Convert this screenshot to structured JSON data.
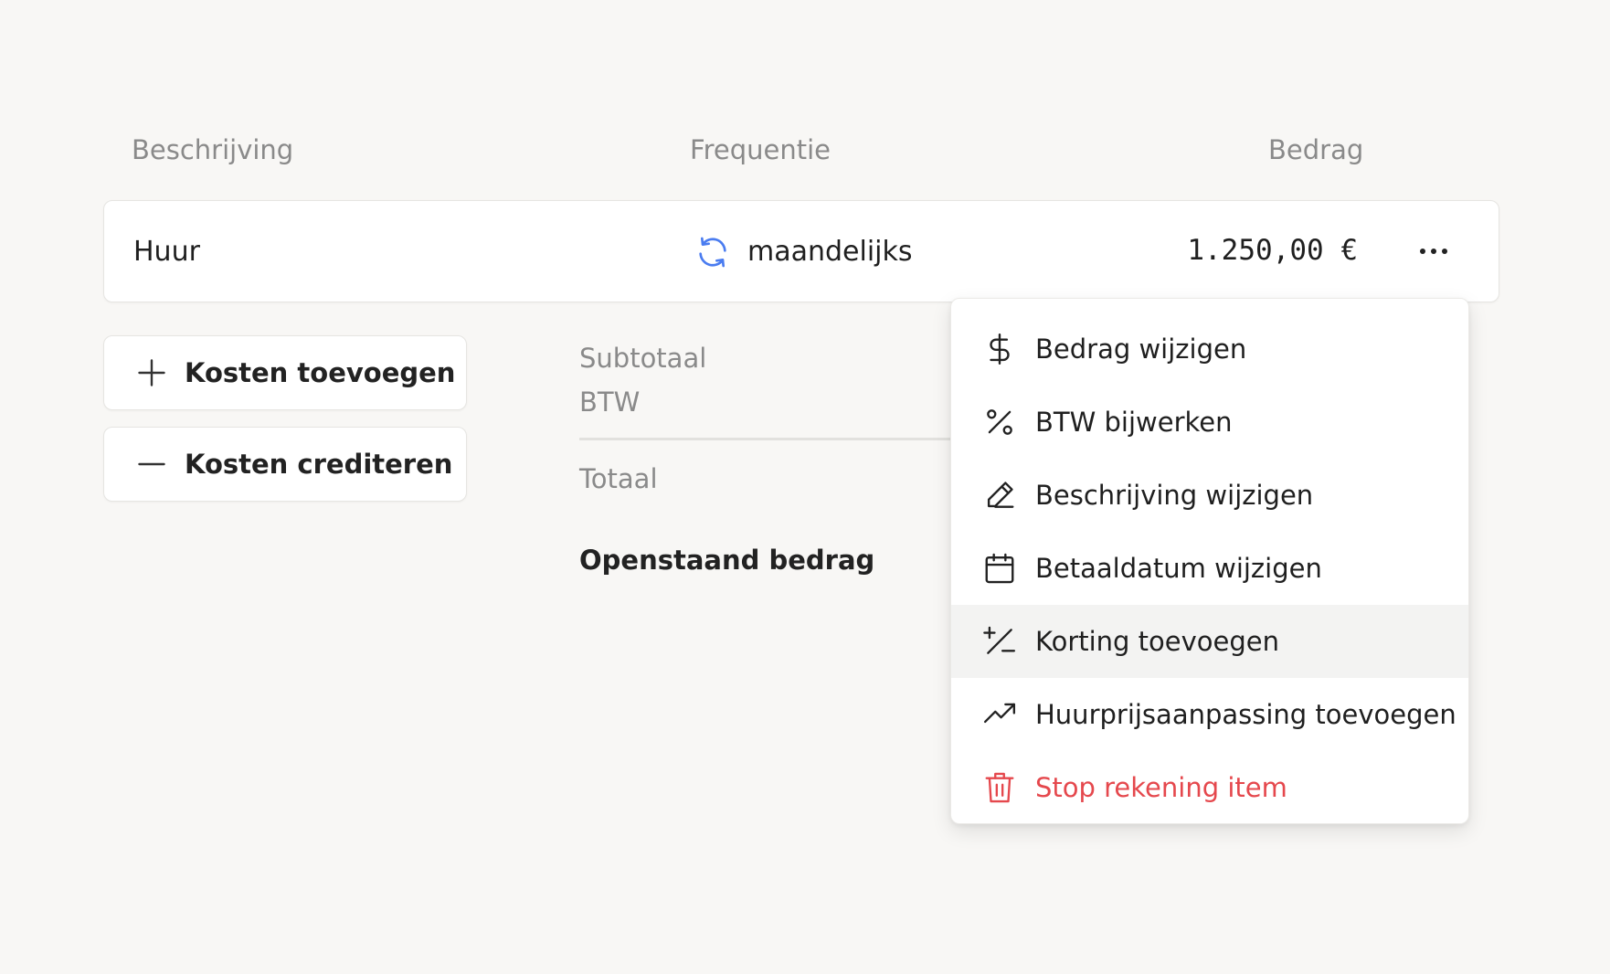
{
  "table": {
    "headers": {
      "description": "Beschrijving",
      "frequency": "Frequentie",
      "amount": "Bedrag"
    },
    "row": {
      "description": "Huur",
      "frequency": "maandelijks",
      "frequency_icon": "refresh-icon",
      "amount": "1.250,00 €",
      "more_icon": "more-horizontal-icon"
    }
  },
  "actions": {
    "add_costs": "Kosten toevoegen",
    "credit_costs": "Kosten crediteren"
  },
  "summary": {
    "subtotal_label": "Subtotaal",
    "vat_label": "BTW",
    "total_label": "Totaal",
    "outstanding_label": "Openstaand bedrag"
  },
  "menu": {
    "items": [
      {
        "label": "Bedrag wijzigen",
        "icon": "dollar-icon"
      },
      {
        "label": "BTW bijwerken",
        "icon": "percent-icon"
      },
      {
        "label": "Beschrijving wijzigen",
        "icon": "pencil-icon"
      },
      {
        "label": "Betaaldatum wijzigen",
        "icon": "calendar-icon"
      },
      {
        "label": "Korting toevoegen",
        "icon": "discount-icon",
        "highlighted": true
      },
      {
        "label": "Huurprijsaanpassing toevoegen",
        "icon": "trending-up-icon"
      },
      {
        "label": "Stop rekening item",
        "icon": "trash-icon",
        "danger": true
      }
    ]
  },
  "colors": {
    "background": "#f8f7f5",
    "accent_blue": "#4a7cf0",
    "danger_red": "#e5484d",
    "muted_text": "#8a8a8a"
  }
}
